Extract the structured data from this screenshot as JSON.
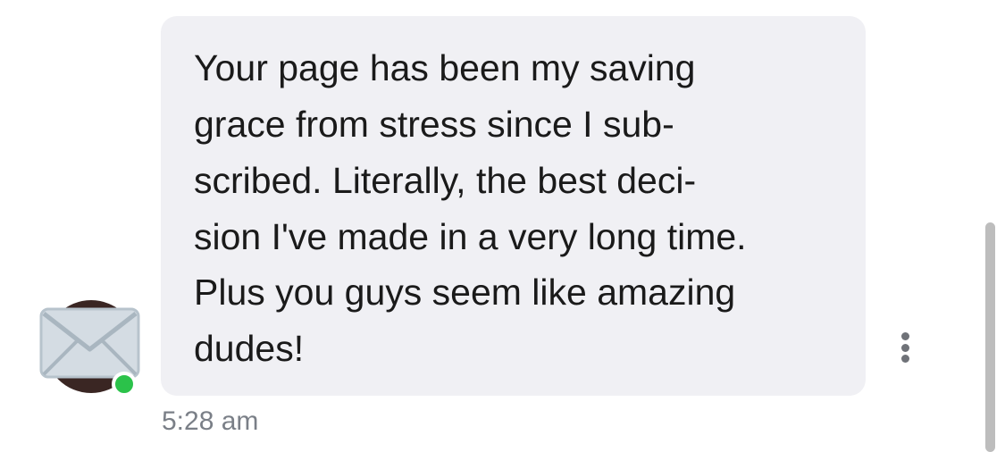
{
  "message": {
    "lines": [
      "Your page has been my saving",
      "grace from stress since I sub-",
      "scribed. Literally, the best deci-",
      "sion I've made in a very long time.",
      "Plus you guys seem like amazing",
      "dudes!"
    ],
    "timestamp": "5:28 am"
  },
  "sender": {
    "avatar_icon": "envelope-icon",
    "online": true
  },
  "colors": {
    "bubble": "#f0f0f4",
    "online_dot": "#2bc24a",
    "timestamp": "#7a7f87"
  },
  "icons": {
    "more": "more-vertical-icon"
  }
}
